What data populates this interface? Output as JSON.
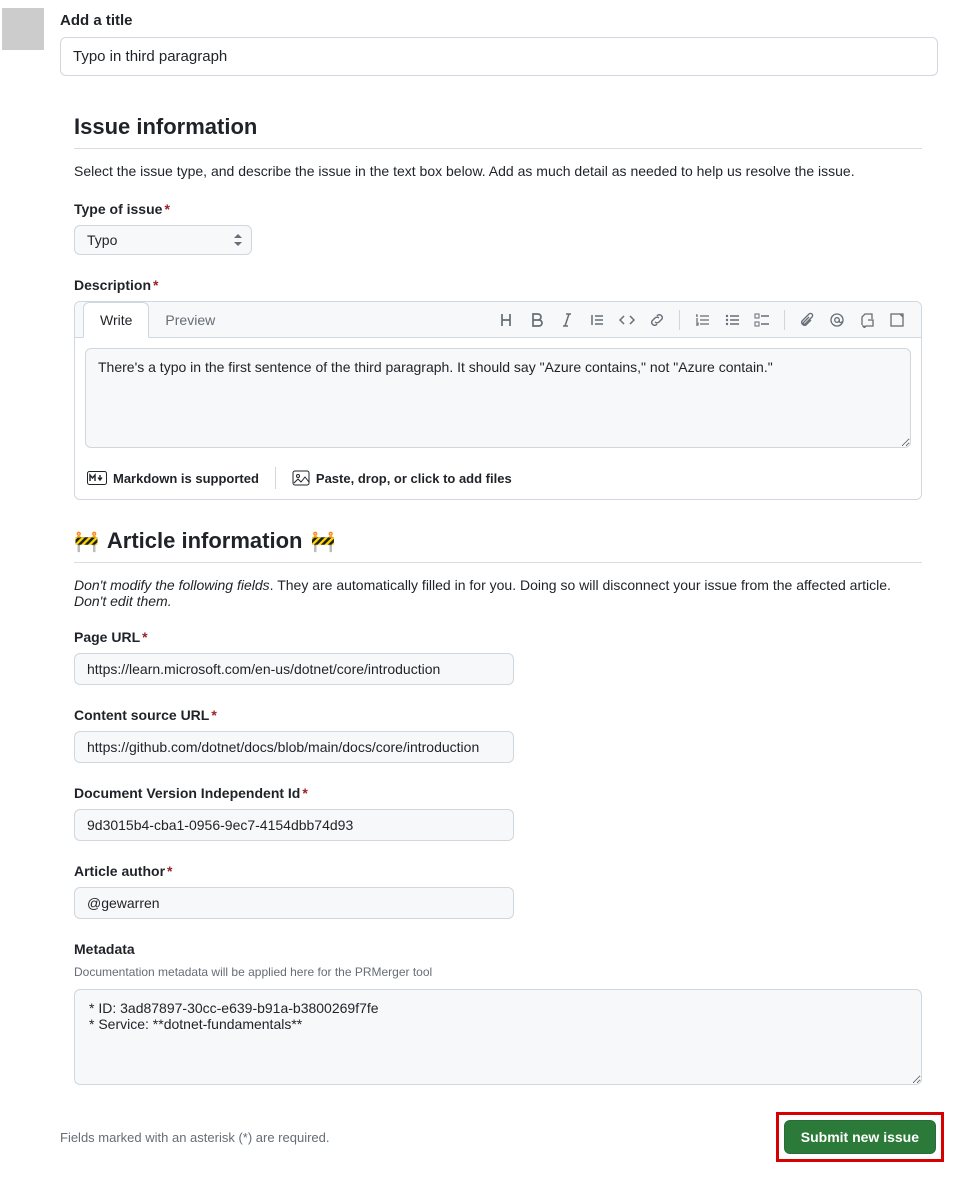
{
  "title": {
    "label": "Add a title",
    "value": "Typo in third paragraph"
  },
  "issue_info": {
    "heading": "Issue information",
    "description": "Select the issue type, and describe the issue in the text box below. Add as much detail as needed to help us resolve the issue.",
    "type_label": "Type of issue",
    "type_value": "Typo"
  },
  "description": {
    "label": "Description",
    "tabs": {
      "write": "Write",
      "preview": "Preview"
    },
    "text": "There's a typo in the first sentence of the third paragraph. It should say \"Azure contains,\" not \"Azure contain.\"",
    "footer": {
      "md_supported": "Markdown is supported",
      "paste_drop": "Paste, drop, or click to add files"
    }
  },
  "article_info": {
    "heading": "Article information",
    "note_italic1": "Don't modify the following fields",
    "note_rest": ". They are automatically filled in for you. Doing so will disconnect your issue from the affected article. ",
    "note_italic2": "Don't edit them.",
    "fields": {
      "page_url": {
        "label": "Page URL",
        "value": "https://learn.microsoft.com/en-us/dotnet/core/introduction"
      },
      "content_source_url": {
        "label": "Content source URL",
        "value": "https://github.com/dotnet/docs/blob/main/docs/core/introduction"
      },
      "doc_version_id": {
        "label": "Document Version Independent Id",
        "value": "9d3015b4-cba1-0956-9ec7-4154dbb74d93"
      },
      "article_author": {
        "label": "Article author",
        "value": "@gewarren"
      }
    },
    "metadata": {
      "label": "Metadata",
      "desc": "Documentation metadata will be applied here for the PRMerger tool",
      "value": "* ID: 3ad87897-30cc-e639-b91a-b3800269f7fe\n* Service: **dotnet-fundamentals**"
    }
  },
  "footer": {
    "required_note": "Fields marked with an asterisk (*) are required.",
    "submit": "Submit new issue"
  }
}
